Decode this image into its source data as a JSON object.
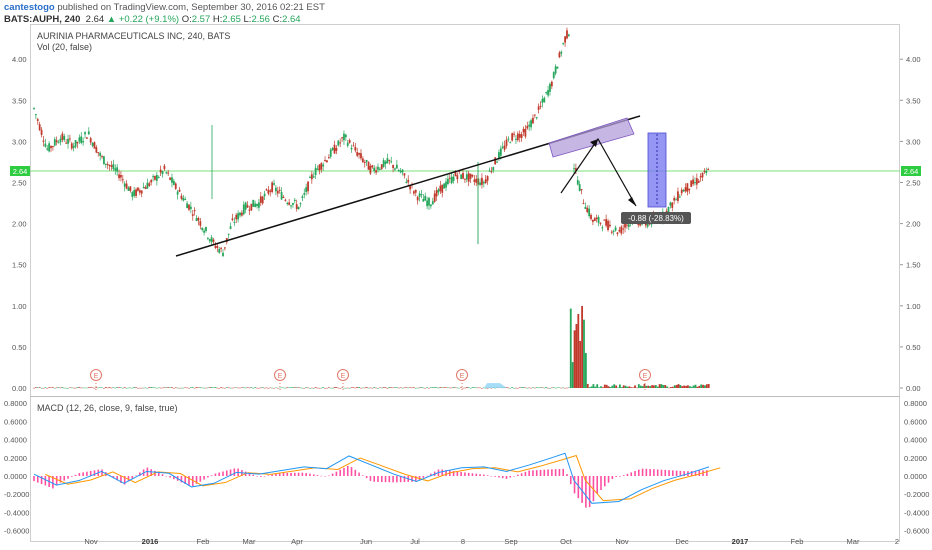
{
  "header": {
    "author": "cantestogo",
    "published_text": "published on TradingView.com, September 30, 2016 02:21 EST",
    "symbol": "BATS:AUPH, 240",
    "last": "2.64",
    "change": "+0.22 (+9.1%)",
    "open_label": "O:",
    "open": "2.57",
    "high_label": "H:",
    "high": "2.65",
    "low_label": "L:",
    "low": "2.56",
    "close_label": "C:",
    "close": "2.64"
  },
  "legend": {
    "title": "AURINIA PHARMACEUTICALS INC, 240, BATS",
    "volume": "Vol (20, false)",
    "macd": "MACD (12, 26, close, 9, false, true)"
  },
  "annotations": {
    "price_badge": "2.64",
    "projection_label": "-0.88 (-28.83%)",
    "earnings_marker": "E"
  },
  "colors": {
    "up": "#26a65b",
    "down": "#c0392b",
    "price_line": "#7ee07e",
    "pattern_fill": "#b39ddb",
    "projection_fill": "#7b7bf0",
    "macd_line": "#2196f3",
    "signal_line": "#ff9800",
    "histogram": "#ff4fa3"
  },
  "chart_data": {
    "type": "candlestick",
    "y_ticks": [
      "4.00",
      "3.50",
      "3.00",
      "2.50",
      "2.00",
      "1.50",
      "1.00",
      "0.50",
      "0.00"
    ],
    "macd_ticks": [
      "0.8000",
      "0.6000",
      "0.4000",
      "0.2000",
      "0.0000",
      "-0.2000",
      "-0.4000",
      "-0.6000"
    ],
    "x_ticks": [
      "Nov",
      "2016",
      "Feb",
      "Mar",
      "Apr",
      "Jun",
      "Jul",
      "8",
      "Sep",
      "Oct",
      "Nov",
      "Dec",
      "2017",
      "Feb",
      "Mar",
      "2"
    ],
    "price_trend": [
      [
        0,
        3.4
      ],
      [
        0.03,
        2.9
      ],
      [
        0.06,
        3.05
      ],
      [
        0.09,
        2.95
      ],
      [
        0.12,
        3.1
      ],
      [
        0.15,
        2.8
      ],
      [
        0.19,
        2.6
      ],
      [
        0.22,
        2.35
      ],
      [
        0.26,
        2.5
      ],
      [
        0.29,
        2.65
      ],
      [
        0.32,
        2.4
      ],
      [
        0.36,
        2.1
      ],
      [
        0.4,
        1.75
      ],
      [
        0.42,
        1.65
      ],
      [
        0.44,
        2.0
      ],
      [
        0.47,
        2.2
      ],
      [
        0.5,
        2.25
      ],
      [
        0.53,
        2.45
      ],
      [
        0.56,
        2.3
      ],
      [
        0.59,
        2.2
      ],
      [
        0.62,
        2.6
      ],
      [
        0.66,
        2.85
      ],
      [
        0.69,
        3.05
      ],
      [
        0.72,
        2.85
      ],
      [
        0.75,
        2.65
      ],
      [
        0.79,
        2.75
      ],
      [
        0.82,
        2.6
      ],
      [
        0.85,
        2.35
      ],
      [
        0.88,
        2.25
      ],
      [
        0.91,
        2.45
      ],
      [
        0.94,
        2.6
      ],
      [
        0.97,
        2.55
      ],
      [
        1.0,
        2.5
      ],
      [
        1.03,
        2.8
      ],
      [
        1.06,
        3.05
      ],
      [
        1.09,
        3.1
      ],
      [
        1.12,
        3.35
      ],
      [
        1.15,
        3.7
      ],
      [
        1.18,
        4.25
      ],
      [
        1.19,
        4.35
      ]
    ],
    "post_gap_trend": [
      [
        1.2,
        2.7
      ],
      [
        1.22,
        2.3
      ],
      [
        1.24,
        2.05
      ],
      [
        1.27,
        2.0
      ],
      [
        1.3,
        1.9
      ],
      [
        1.33,
        2.05
      ],
      [
        1.36,
        2.0
      ],
      [
        1.4,
        2.1
      ],
      [
        1.44,
        2.4
      ],
      [
        1.47,
        2.5
      ],
      [
        1.5,
        2.64
      ]
    ],
    "current_price": 2.64,
    "projection_change": -0.88,
    "projection_change_pct": -28.83
  }
}
